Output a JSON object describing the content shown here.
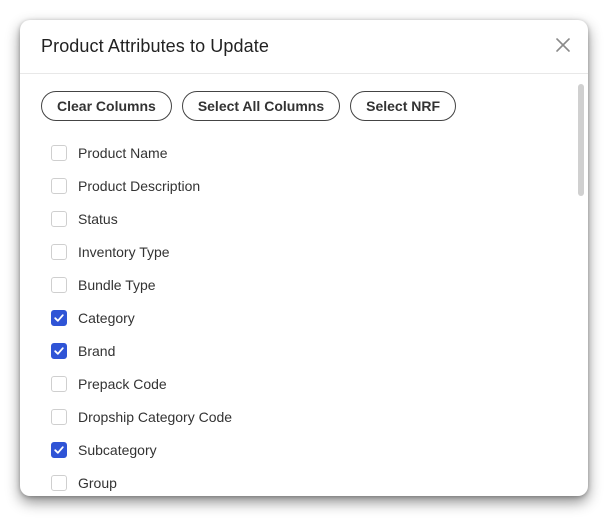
{
  "modal": {
    "title": "Product Attributes to Update"
  },
  "actions": {
    "clear_columns": "Clear Columns",
    "select_all_columns": "Select All Columns",
    "select_nrf": "Select NRF"
  },
  "attributes": [
    {
      "label": "Product Name",
      "checked": false
    },
    {
      "label": "Product Description",
      "checked": false
    },
    {
      "label": "Status",
      "checked": false
    },
    {
      "label": "Inventory Type",
      "checked": false
    },
    {
      "label": "Bundle Type",
      "checked": false
    },
    {
      "label": "Category",
      "checked": true
    },
    {
      "label": "Brand",
      "checked": true
    },
    {
      "label": "Prepack Code",
      "checked": false
    },
    {
      "label": "Dropship Category Code",
      "checked": false
    },
    {
      "label": "Subcategory",
      "checked": true
    },
    {
      "label": "Group",
      "checked": false
    }
  ],
  "colors": {
    "accent": "#2f54d6",
    "border": "#cfcfcf",
    "text": "#333333"
  }
}
